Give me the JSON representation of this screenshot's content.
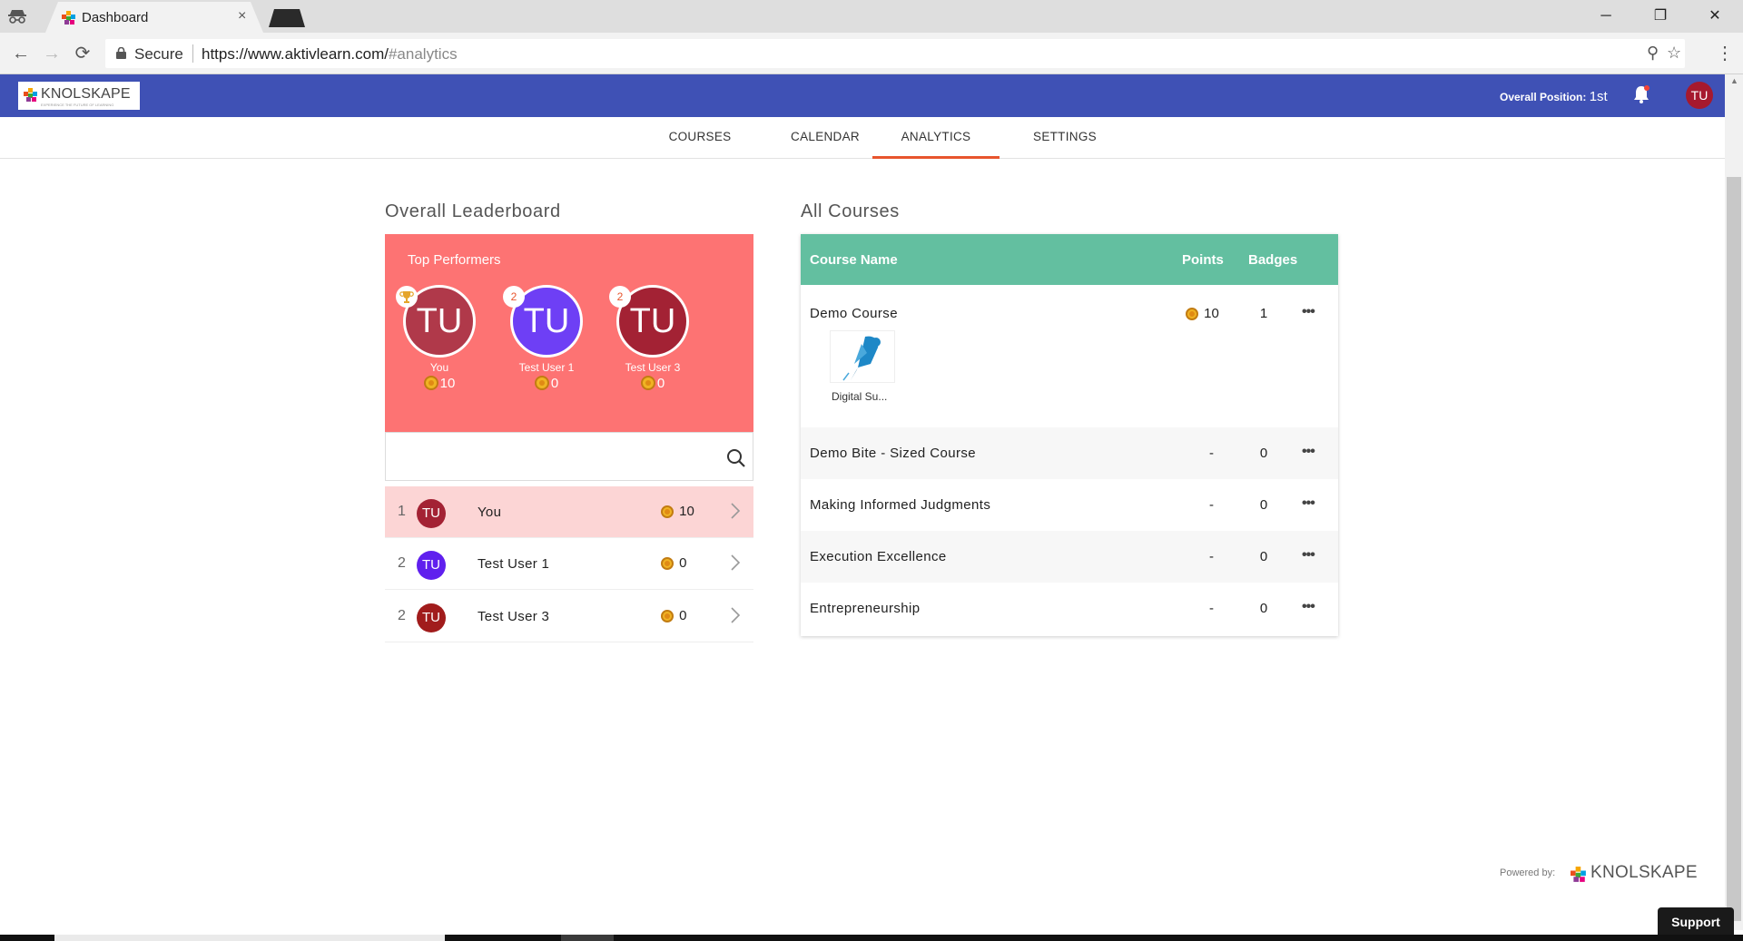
{
  "browser": {
    "tab_title": "Dashboard",
    "tab_close": "×",
    "secure_label": "Secure",
    "url_host": "https://www.aktivlearn.com/",
    "url_path": "#analytics",
    "window_controls": {
      "minimize": "─",
      "maximize": "❐",
      "close": "✕"
    },
    "nav": {
      "back": "←",
      "forward": "→",
      "reload": "⟳"
    },
    "zoom_icon": "⚲",
    "bookmark_icon": "☆",
    "menu_icon": "⋮"
  },
  "header": {
    "logo_text": "KNOLSKAPE",
    "logo_tagline": "EXPERIENCE THE FUTURE OF LEARNING",
    "position_label": "Overall Position: ",
    "position_value": "1st",
    "user_initials": "TU",
    "brand_color": "#3f51b5"
  },
  "tabs": [
    {
      "label": "COURSES",
      "active": false
    },
    {
      "label": "CALENDAR",
      "active": false
    },
    {
      "label": "ANALYTICS",
      "active": true
    },
    {
      "label": "SETTINGS",
      "active": false
    }
  ],
  "leaderboard": {
    "section_title": "Overall Leaderboard",
    "panel_title": "Top Performers",
    "panel_color": "#fd7373",
    "top_performers": [
      {
        "initials": "TU",
        "name": "You",
        "points": "10",
        "badge": "trophy",
        "color": "#b0394a"
      },
      {
        "initials": "TU",
        "name": "Test User 1",
        "points": "0",
        "badge": "2",
        "color": "#6e3ff5"
      },
      {
        "initials": "TU",
        "name": "Test User 3",
        "points": "0",
        "badge": "2",
        "color": "#a32234"
      }
    ],
    "search_placeholder": "",
    "rows": [
      {
        "rank": "1",
        "initials": "TU",
        "name": "You",
        "points": "10",
        "color": "#a32234"
      },
      {
        "rank": "2",
        "initials": "TU",
        "name": "Test User 1",
        "points": "0",
        "color": "#6020ee"
      },
      {
        "rank": "2",
        "initials": "TU",
        "name": "Test User 3",
        "points": "0",
        "color": "#a11c1c"
      }
    ]
  },
  "courses": {
    "section_title": "All Courses",
    "header_color": "#63bfa0",
    "columns": {
      "name": "Course Name",
      "points": "Points",
      "badges": "Badges"
    },
    "rows": [
      {
        "name": "Demo Course",
        "points": "10",
        "badges": "1",
        "badge_caption": "Digital Su..."
      },
      {
        "name": "Demo Bite - Sized Course",
        "points": "-",
        "badges": "0"
      },
      {
        "name": "Making Informed Judgments",
        "points": "-",
        "badges": "0"
      },
      {
        "name": "Execution Excellence",
        "points": "-",
        "badges": "0"
      },
      {
        "name": "Entrepreneurship",
        "points": "-",
        "badges": "0"
      }
    ],
    "more_label": "•••"
  },
  "footer": {
    "powered_by": "Powered by:",
    "logo_text": "KNOLSKAPE",
    "support_label": "Support"
  }
}
